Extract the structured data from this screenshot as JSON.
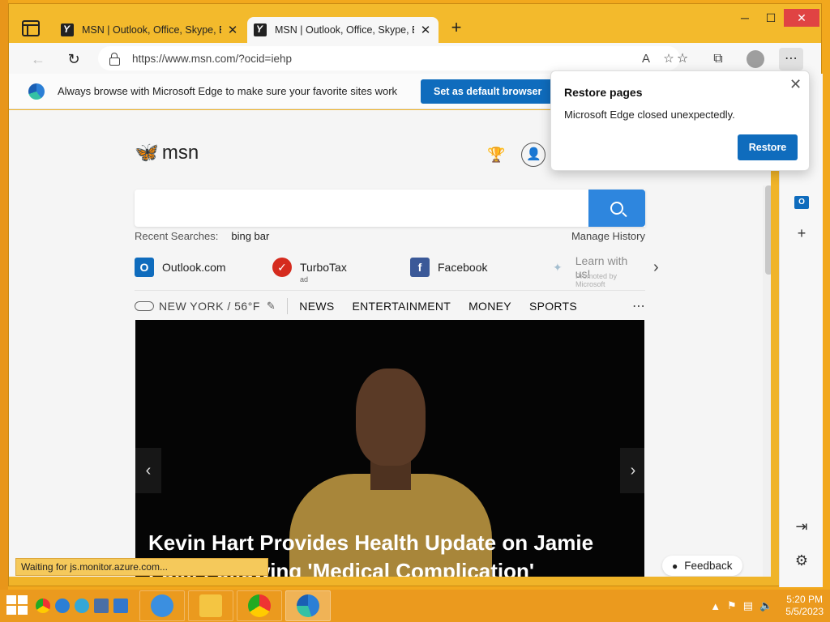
{
  "window": {
    "tabs": [
      {
        "title": "MSN | Outlook, Office, Skype, Bir"
      },
      {
        "title": "MSN | Outlook, Office, Skype, Bir"
      }
    ],
    "controls": {
      "minimize": "─",
      "maximize": "☐",
      "close": "✕"
    }
  },
  "toolbar": {
    "url": "https://www.msn.com/?ocid=iehp",
    "icons": [
      "back-icon",
      "refresh-icon",
      "read-aloud-icon",
      "favorite-add-icon",
      "favorites-icon",
      "collections-icon",
      "profile-icon",
      "more-icon"
    ]
  },
  "infobar": {
    "text": "Always browse with Microsoft Edge to make sure your favorite sites work",
    "button": "Set as default browser"
  },
  "popup": {
    "title": "Restore pages",
    "body": "Microsoft Edge closed unexpectedly.",
    "button": "Restore"
  },
  "msn": {
    "logo": "msn",
    "recent_label": "Recent Searches:",
    "recent_term": "bing bar",
    "manage_history": "Manage History",
    "quicklinks": [
      {
        "label": "Outlook.com",
        "sub": "",
        "color": "#0f6cbd",
        "glyph": "O"
      },
      {
        "label": "TurboTax",
        "sub": "ad",
        "color": "#d52b1e",
        "glyph": "✓"
      },
      {
        "label": "Facebook",
        "sub": "",
        "color": "#3b5998",
        "glyph": "f"
      },
      {
        "label": "Learn with us!",
        "sub": "Promoted by Microsoft",
        "color": "#9ab",
        "glyph": "💡"
      }
    ],
    "weather": "NEW YORK / 56°F",
    "nav": [
      "NEWS",
      "ENTERTAINMENT",
      "MONEY",
      "SPORTS"
    ],
    "hero_title": "Kevin Hart Provides Health Update on Jamie Foxx Following 'Medical Complication'",
    "feedback": "Feedback"
  },
  "status": "Waiting for js.monitor.azure.com...",
  "taskbar": {
    "time": "5:20 PM",
    "date": "5/5/2023"
  }
}
